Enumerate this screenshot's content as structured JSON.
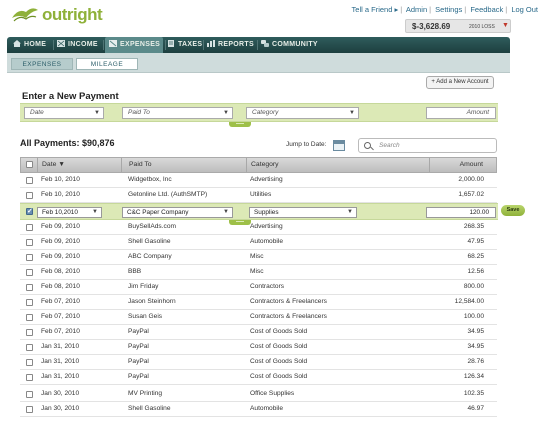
{
  "brand": {
    "name": "outright",
    "accent": "#8fb13a"
  },
  "top_links": [
    "Tell a Friend ▸",
    "Admin",
    "Settings",
    "Feedback",
    "Log Out"
  ],
  "loss_box": {
    "amount": "$-3,628.69",
    "label": "2010 LOSS"
  },
  "nav": {
    "items": [
      {
        "label": "HOME",
        "icon": "home-icon"
      },
      {
        "label": "INCOME",
        "icon": "income-icon"
      },
      {
        "label": "EXPENSES",
        "icon": "expenses-icon",
        "active": true
      },
      {
        "label": "TAXES",
        "icon": "taxes-icon"
      },
      {
        "label": "REPORTS",
        "icon": "reports-icon"
      },
      {
        "label": "COMMUNITY",
        "icon": "community-icon"
      }
    ]
  },
  "subtabs": {
    "expenses": "EXPENSES",
    "mileage": "MILEAGE"
  },
  "add_account": "+ Add a New Account",
  "new_payment": {
    "title": "Enter a New Payment",
    "date_placeholder": "Date",
    "paid_to_placeholder": "Paid To",
    "category_placeholder": "Category",
    "amount_placeholder": "Amount"
  },
  "all_payments": "All Payments: $90,876",
  "jump_to_date": "Jump to Date:",
  "search_placeholder": "Search",
  "table": {
    "headers": {
      "date": "Date ▼",
      "paid_to": "Paid To",
      "category": "Category",
      "amount": "Amount"
    },
    "rows": [
      {
        "date": "Feb 10, 2010",
        "paid_to": "Widgetbox, Inc",
        "category": "Advertising",
        "amount": "2,000.00"
      },
      {
        "date": "Feb 10, 2010",
        "paid_to": "Getonline Ltd. (AuthSMTP)",
        "category": "Utilities",
        "amount": "1,657.02"
      },
      {
        "date": "Feb 09, 2010",
        "paid_to": "BuySellAds.com",
        "category": "Advertising",
        "amount": "268.35"
      },
      {
        "date": "Feb 09, 2010",
        "paid_to": "Shell Gasoline",
        "category": "Automobile",
        "amount": "47.95"
      },
      {
        "date": "Feb 09, 2010",
        "paid_to": "ABC Company",
        "category": "Misc",
        "amount": "68.25"
      },
      {
        "date": "Feb 08, 2010",
        "paid_to": "BBB",
        "category": "Misc",
        "amount": "12.56"
      },
      {
        "date": "Feb 08, 2010",
        "paid_to": "Jim Friday",
        "category": "Contractors",
        "amount": "800.00"
      },
      {
        "date": "Feb 07, 2010",
        "paid_to": "Jason Steinhorn",
        "category": "Contractors & Freelancers",
        "amount": "12,584.00"
      },
      {
        "date": "Feb 07, 2010",
        "paid_to": "Susan Geis",
        "category": "Contractors & Freelancers",
        "amount": "100.00"
      },
      {
        "date": "Feb 07, 2010",
        "paid_to": "PayPal",
        "category": "Cost of Goods Sold",
        "amount": "34.95"
      },
      {
        "date": "Jan 31, 2010",
        "paid_to": "PayPal",
        "category": "Cost of Goods Sold",
        "amount": "34.95"
      },
      {
        "date": "Jan 31, 2010",
        "paid_to": "PayPal",
        "category": "Cost of Goods Sold",
        "amount": "28.76"
      },
      {
        "date": "Jan 31, 2010",
        "paid_to": "PayPal",
        "category": "Cost of Goods Sold",
        "amount": "126.34"
      },
      {
        "date": "Jan 30, 2010",
        "paid_to": "MV Printing",
        "category": "Office Supplies",
        "amount": "102.35"
      },
      {
        "date": "Jan 30, 2010",
        "paid_to": "Shell Gasoline",
        "category": "Automobile",
        "amount": "46.97"
      }
    ],
    "edit_row": {
      "date": "Feb 10,2010",
      "paid_to": "C&C Paper Company",
      "category": "Supplies",
      "amount": "120.00",
      "save": "Save"
    }
  }
}
